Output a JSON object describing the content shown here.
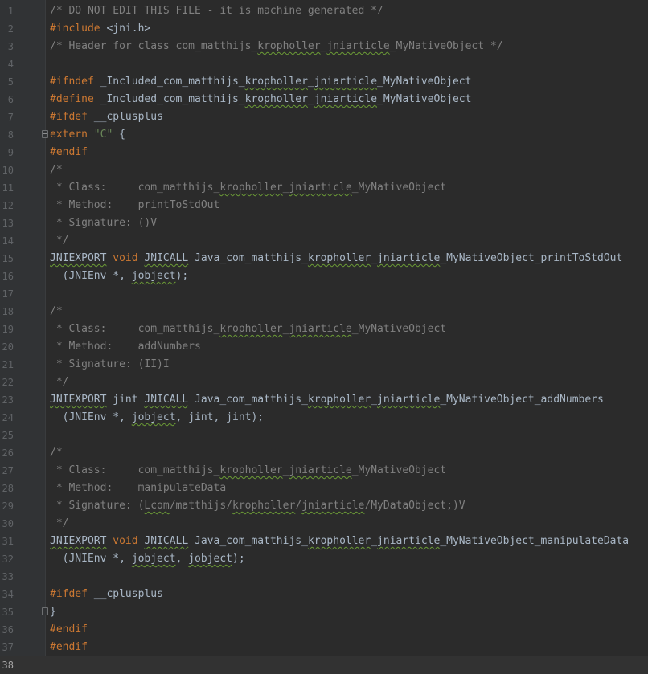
{
  "editor": {
    "current_line": 38,
    "lines": [
      {
        "n": "1",
        "tokens": [
          {
            "t": "/* DO NOT EDIT THIS FILE - it is machine generated */",
            "c": "comment"
          }
        ]
      },
      {
        "n": "2",
        "tokens": [
          {
            "t": "#include ",
            "c": "pre"
          },
          {
            "t": "<jni.h>",
            "c": "inc"
          }
        ]
      },
      {
        "n": "3",
        "tokens": [
          {
            "t": "/* Header for class com_matthijs_",
            "c": "comment"
          },
          {
            "t": "kropholler",
            "c": "comment typo"
          },
          {
            "t": "_",
            "c": "comment"
          },
          {
            "t": "jniarticle",
            "c": "comment typo"
          },
          {
            "t": "_MyNativeObject */",
            "c": "comment"
          }
        ]
      },
      {
        "n": "4",
        "tokens": []
      },
      {
        "n": "5",
        "tokens": [
          {
            "t": "#ifndef ",
            "c": "pre"
          },
          {
            "t": "_Included_com_matthijs_",
            "c": "plain"
          },
          {
            "t": "kropholler",
            "c": "plain typo"
          },
          {
            "t": "_",
            "c": "plain"
          },
          {
            "t": "jniarticle",
            "c": "plain typo"
          },
          {
            "t": "_MyNativeObject",
            "c": "plain"
          }
        ]
      },
      {
        "n": "6",
        "tokens": [
          {
            "t": "#define ",
            "c": "pre"
          },
          {
            "t": "_Included_com_matthijs_",
            "c": "plain"
          },
          {
            "t": "kropholler",
            "c": "plain typo"
          },
          {
            "t": "_",
            "c": "plain"
          },
          {
            "t": "jniarticle",
            "c": "plain typo"
          },
          {
            "t": "_MyNativeObject",
            "c": "plain"
          }
        ]
      },
      {
        "n": "7",
        "tokens": [
          {
            "t": "#ifdef ",
            "c": "pre"
          },
          {
            "t": "__cplusplus",
            "c": "plain"
          }
        ]
      },
      {
        "n": "8",
        "fold": true,
        "tokens": [
          {
            "t": "extern ",
            "c": "kw"
          },
          {
            "t": "\"C\"",
            "c": "str"
          },
          {
            "t": " {",
            "c": "plain"
          }
        ]
      },
      {
        "n": "9",
        "tokens": [
          {
            "t": "#endif",
            "c": "pre"
          }
        ]
      },
      {
        "n": "10",
        "tokens": [
          {
            "t": "/*",
            "c": "comment"
          }
        ]
      },
      {
        "n": "11",
        "tokens": [
          {
            "t": " * Class:     com_matthijs_",
            "c": "comment"
          },
          {
            "t": "kropholler",
            "c": "comment typo"
          },
          {
            "t": "_",
            "c": "comment"
          },
          {
            "t": "jniarticle",
            "c": "comment typo"
          },
          {
            "t": "_MyNativeObject",
            "c": "comment"
          }
        ]
      },
      {
        "n": "12",
        "tokens": [
          {
            "t": " * Method:    printToStdOut",
            "c": "comment"
          }
        ]
      },
      {
        "n": "13",
        "tokens": [
          {
            "t": " * Signature: ()V",
            "c": "comment"
          }
        ]
      },
      {
        "n": "14",
        "tokens": [
          {
            "t": " */",
            "c": "comment"
          }
        ]
      },
      {
        "n": "15",
        "tokens": [
          {
            "t": "JNIEXPORT",
            "c": "plain typo"
          },
          {
            "t": " ",
            "c": "plain"
          },
          {
            "t": "void",
            "c": "kw"
          },
          {
            "t": " ",
            "c": "plain"
          },
          {
            "t": "JNICALL",
            "c": "plain typo"
          },
          {
            "t": " Java_com_matthijs_",
            "c": "plain"
          },
          {
            "t": "kropholler",
            "c": "plain typo"
          },
          {
            "t": "_",
            "c": "plain"
          },
          {
            "t": "jniarticle",
            "c": "plain typo"
          },
          {
            "t": "_MyNativeObject_printToStdOut",
            "c": "plain"
          }
        ]
      },
      {
        "n": "16",
        "tokens": [
          {
            "t": "  (JNIEnv *, ",
            "c": "plain"
          },
          {
            "t": "jobject",
            "c": "plain typo"
          },
          {
            "t": ");",
            "c": "plain"
          }
        ]
      },
      {
        "n": "17",
        "tokens": []
      },
      {
        "n": "18",
        "tokens": [
          {
            "t": "/*",
            "c": "comment"
          }
        ]
      },
      {
        "n": "19",
        "tokens": [
          {
            "t": " * Class:     com_matthijs_",
            "c": "comment"
          },
          {
            "t": "kropholler",
            "c": "comment typo"
          },
          {
            "t": "_",
            "c": "comment"
          },
          {
            "t": "jniarticle",
            "c": "comment typo"
          },
          {
            "t": "_MyNativeObject",
            "c": "comment"
          }
        ]
      },
      {
        "n": "20",
        "tokens": [
          {
            "t": " * Method:    addNumbers",
            "c": "comment"
          }
        ]
      },
      {
        "n": "21",
        "tokens": [
          {
            "t": " * Signature: (II)I",
            "c": "comment"
          }
        ]
      },
      {
        "n": "22",
        "tokens": [
          {
            "t": " */",
            "c": "comment"
          }
        ]
      },
      {
        "n": "23",
        "tokens": [
          {
            "t": "JNIEXPORT",
            "c": "plain typo"
          },
          {
            "t": " jint ",
            "c": "plain"
          },
          {
            "t": "JNICALL",
            "c": "plain typo"
          },
          {
            "t": " Java_com_matthijs_",
            "c": "plain"
          },
          {
            "t": "kropholler",
            "c": "plain typo"
          },
          {
            "t": "_",
            "c": "plain"
          },
          {
            "t": "jniarticle",
            "c": "plain typo"
          },
          {
            "t": "_MyNativeObject_addNumbers",
            "c": "plain"
          }
        ]
      },
      {
        "n": "24",
        "tokens": [
          {
            "t": "  (JNIEnv *, ",
            "c": "plain"
          },
          {
            "t": "jobject",
            "c": "plain typo"
          },
          {
            "t": ", jint, jint);",
            "c": "plain"
          }
        ]
      },
      {
        "n": "25",
        "tokens": []
      },
      {
        "n": "26",
        "tokens": [
          {
            "t": "/*",
            "c": "comment"
          }
        ]
      },
      {
        "n": "27",
        "tokens": [
          {
            "t": " * Class:     com_matthijs_",
            "c": "comment"
          },
          {
            "t": "kropholler",
            "c": "comment typo"
          },
          {
            "t": "_",
            "c": "comment"
          },
          {
            "t": "jniarticle",
            "c": "comment typo"
          },
          {
            "t": "_MyNativeObject",
            "c": "comment"
          }
        ]
      },
      {
        "n": "28",
        "tokens": [
          {
            "t": " * Method:    manipulateData",
            "c": "comment"
          }
        ]
      },
      {
        "n": "29",
        "tokens": [
          {
            "t": " * Signature: (",
            "c": "comment"
          },
          {
            "t": "Lcom",
            "c": "comment typo"
          },
          {
            "t": "/matthijs/",
            "c": "comment"
          },
          {
            "t": "kropholler",
            "c": "comment typo"
          },
          {
            "t": "/",
            "c": "comment"
          },
          {
            "t": "jniarticle",
            "c": "comment typo"
          },
          {
            "t": "/MyDataObject;)V",
            "c": "comment"
          }
        ]
      },
      {
        "n": "30",
        "tokens": [
          {
            "t": " */",
            "c": "comment"
          }
        ]
      },
      {
        "n": "31",
        "tokens": [
          {
            "t": "JNIEXPORT",
            "c": "plain typo"
          },
          {
            "t": " ",
            "c": "plain"
          },
          {
            "t": "void",
            "c": "kw"
          },
          {
            "t": " ",
            "c": "plain"
          },
          {
            "t": "JNICALL",
            "c": "plain typo"
          },
          {
            "t": " Java_com_matthijs_",
            "c": "plain"
          },
          {
            "t": "kropholler",
            "c": "plain typo"
          },
          {
            "t": "_",
            "c": "plain"
          },
          {
            "t": "jniarticle",
            "c": "plain typo"
          },
          {
            "t": "_MyNativeObject_manipulateData",
            "c": "plain"
          }
        ]
      },
      {
        "n": "32",
        "tokens": [
          {
            "t": "  (JNIEnv *, ",
            "c": "plain"
          },
          {
            "t": "jobject",
            "c": "plain typo"
          },
          {
            "t": ", ",
            "c": "plain"
          },
          {
            "t": "jobject",
            "c": "plain typo"
          },
          {
            "t": ");",
            "c": "plain"
          }
        ]
      },
      {
        "n": "33",
        "tokens": []
      },
      {
        "n": "34",
        "tokens": [
          {
            "t": "#ifdef ",
            "c": "pre"
          },
          {
            "t": "__cplusplus",
            "c": "plain"
          }
        ]
      },
      {
        "n": "35",
        "fold": true,
        "tokens": [
          {
            "t": "}",
            "c": "plain"
          }
        ]
      },
      {
        "n": "36",
        "tokens": [
          {
            "t": "#endif",
            "c": "pre"
          }
        ]
      },
      {
        "n": "37",
        "tokens": [
          {
            "t": "#endif",
            "c": "pre"
          }
        ]
      },
      {
        "n": "38",
        "tokens": []
      }
    ]
  },
  "colors": {
    "background": "#2b2b2b",
    "gutter": "#313335",
    "comment": "#808080",
    "keyword": "#cc7832",
    "string": "#6a8759",
    "plain": "#a9b7c6",
    "line_number": "#606366",
    "typo_underline": "#6b9b36"
  }
}
